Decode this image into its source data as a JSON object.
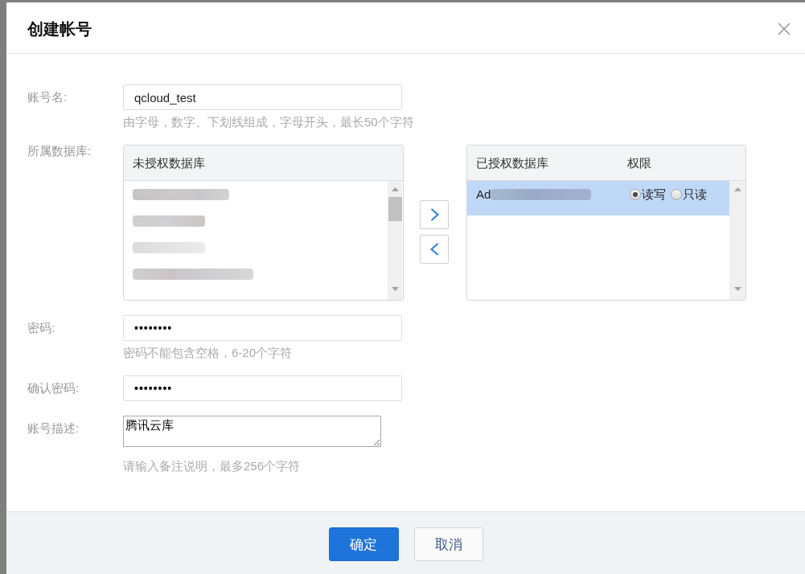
{
  "dialog": {
    "title": "创建帐号"
  },
  "fields": [
    {
      "kind": "input",
      "label": "账号名:",
      "value": "qcloud_test",
      "hint": "由字母，数字、下划线组成，字母开头，最长50个字符"
    },
    {
      "kind": "transfer",
      "label": "所属数据库:",
      "available": {
        "heading": "未授权数据库",
        "items": [
          {
            "kind": "redacted"
          },
          {
            "kind": "redacted"
          },
          {
            "kind": "redacted"
          },
          {
            "kind": "redacted"
          }
        ]
      },
      "granted": {
        "heading": "已授权数据库",
        "permission_heading": "权限",
        "rows": [
          {
            "name": "Ad",
            "redacted": true,
            "selected": true,
            "permissions": [
              {
                "label": "读写",
                "selected": true
              },
              {
                "label": "只读",
                "selected": false
              }
            ]
          }
        ]
      }
    },
    {
      "kind": "password",
      "label": "密码:",
      "value": "••••••••",
      "hint": "密码不能包含空格，6-20个字符"
    },
    {
      "kind": "password",
      "label": "确认密码:",
      "value": "••••••••"
    },
    {
      "kind": "textarea",
      "label": "账号描述:",
      "value": "腾讯云库",
      "hint": "请输入备注说明，最多256个字符"
    }
  ],
  "buttons": [
    {
      "kind": "primary",
      "label": "确定"
    },
    {
      "kind": "secondary",
      "label": "取消"
    }
  ]
}
